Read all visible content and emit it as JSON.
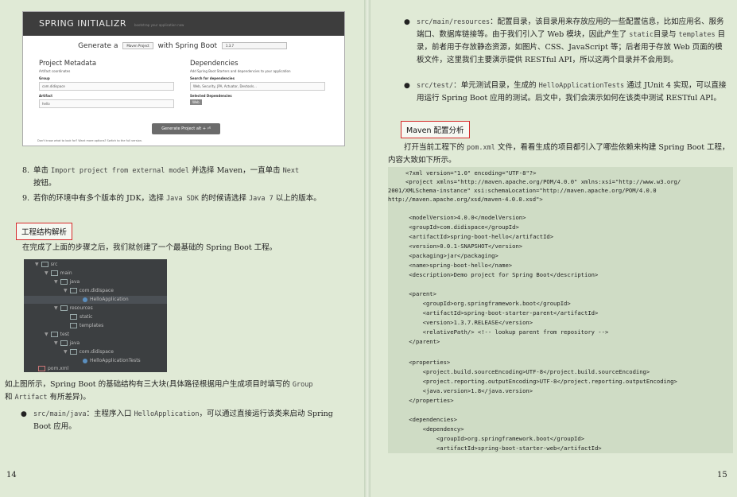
{
  "left_page": {
    "initializr": {
      "title": "SPRING INITIALIZR",
      "subtitle": "bootstrap your application now",
      "generate_prefix": "Generate a",
      "project_type": "Maven Project",
      "with_label": "with Spring Boot",
      "boot_version": "1.3.7",
      "metadata_title": "Project Metadata",
      "metadata_sub": "Artifact coordinates",
      "group_label": "Group",
      "group_value": "com.didispace",
      "artifact_label": "Artifact",
      "artifact_value": "hello",
      "deps_title": "Dependencies",
      "deps_sub": "Add Spring Boot Starters and dependencies to your application",
      "search_label": "Search for dependencies",
      "search_placeholder": "Web, Security, JPA, Actuator, Devtools...",
      "selected_label": "Selected Dependencies",
      "selected_chip": "Web",
      "generate_button": "Generate Project  alt + ⏎",
      "footer": "Don't know what to look for? Want more options? Switch to the full version."
    },
    "step8": {
      "num": "8.",
      "a": "单击 ",
      "code1": "Import project from external model",
      "b": " 并选择 Maven，一直单击 ",
      "code2": "Next",
      "c": "按钮。"
    },
    "step9": {
      "num": "9.",
      "a": "若你的环境中有多个版本的 JDK，选择 ",
      "code1": "Java SDK",
      "b": " 的时候请选择 ",
      "code2": "Java 7",
      "c": " 以上的版本。"
    },
    "section_title": "工程结构解析",
    "intro": "在完成了上面的步骤之后，我们就创建了一个最基础的 Spring Boot 工程。",
    "tree": [
      "src",
      "main",
      "java",
      "com.didispace",
      "HelloApplication",
      "resources",
      "static",
      "templates",
      "test",
      "java",
      "com.didispace",
      "HelloApplicationTests",
      "pom.xml"
    ],
    "summary_a": "如上图所示，Spring Boot 的基础结构有三大块(具体路径根据用户生成项目时填写的 ",
    "summary_code1": "Group",
    "summary_b": "和 ",
    "summary_code2": "Artifact",
    "summary_c": " 有所差异)。",
    "bullet_java_code": "src/main/java",
    "bullet_java_a": "：主程序入口 ",
    "bullet_java_code2": "HelloApplication",
    "bullet_java_b": "，可以通过直接运行该类来启动 Spring Boot 应用。",
    "page_number": "14"
  },
  "right_page": {
    "bullet_res_code": "src/main/resources",
    "bullet_res_text": "：配置目录，该目录用来存放应用的一些配置信息，比如应用名、服务端口、数据库链接等。由于我们引入了 Web 模块，因此产生了 ",
    "bullet_res_code2": "static",
    "bullet_res_text2": "目录与 ",
    "bullet_res_code3": "templates",
    "bullet_res_text3": " 目录，前者用于存放静态资源，如图片、CSS、JavaScript 等；后者用于存放 Web 页面的模板文件，这里我们主要演示提供 RESTful API，所以这两个目录并不会用到。",
    "bullet_test_code": "src/test/",
    "bullet_test_text": "：单元测试目录，生成的 ",
    "bullet_test_code2": "HelloApplicationTests",
    "bullet_test_text2": " 通过 JUnit 4 实现，可以直接用运行 Spring Boot 应用的测试。后文中，我们会演示如何在该类中测试 RESTful API。",
    "section_title": "Maven 配置分析",
    "intro_a": "打开当前工程下的 ",
    "intro_code": "pom.xml",
    "intro_b": " 文件，看看生成的项目都引入了哪些依赖来构建 Spring Boot 工程，内容大致如下所示。",
    "code_lines": [
      "<?xml version=\"1.0\" encoding=\"UTF-8\"?>",
      "<project xmlns=\"http://maven.apache.org/POM/4.0.0\" xmlns:xsi=\"http://www.w3.org/",
      "2001/XMLSchema-instance\" xsi:schemaLocation=\"http://maven.apache.org/POM/4.0.0",
      "http://maven.apache.org/xsd/maven-4.0.0.xsd\">",
      "",
      "    <modelVersion>4.0.0</modelVersion>",
      "    <groupId>com.didispace</groupId>",
      "    <artifactId>spring-boot-hello</artifactId>",
      "    <version>0.0.1-SNAPSHOT</version>",
      "    <packaging>jar</packaging>",
      "    <name>spring-boot-hello</name>",
      "    <description>Demo project for Spring Boot</description>",
      "",
      "    <parent>",
      "        <groupId>org.springframework.boot</groupId>",
      "        <artifactId>spring-boot-starter-parent</artifactId>",
      "        <version>1.3.7.RELEASE</version>",
      "        <relativePath/> <!-- lookup parent from repository -->",
      "    </parent>",
      "",
      "    <properties>",
      "        <project.build.sourceEncoding>UTF-8</project.build.sourceEncoding>",
      "        <project.reporting.outputEncoding>UTF-8</project.reporting.outputEncoding>",
      "        <java.version>1.8</java.version>",
      "    </properties>",
      "",
      "    <dependencies>",
      "        <dependency>",
      "            <groupId>org.springframework.boot</groupId>",
      "            <artifactId>spring-boot-starter-web</artifactId>"
    ],
    "page_number": "15"
  },
  "colors": {
    "page_bg": "#e0ead6",
    "highlight_border": "#d62a2a",
    "code_bg": "#cfdcc5",
    "tree_bg": "#3c3f41"
  }
}
